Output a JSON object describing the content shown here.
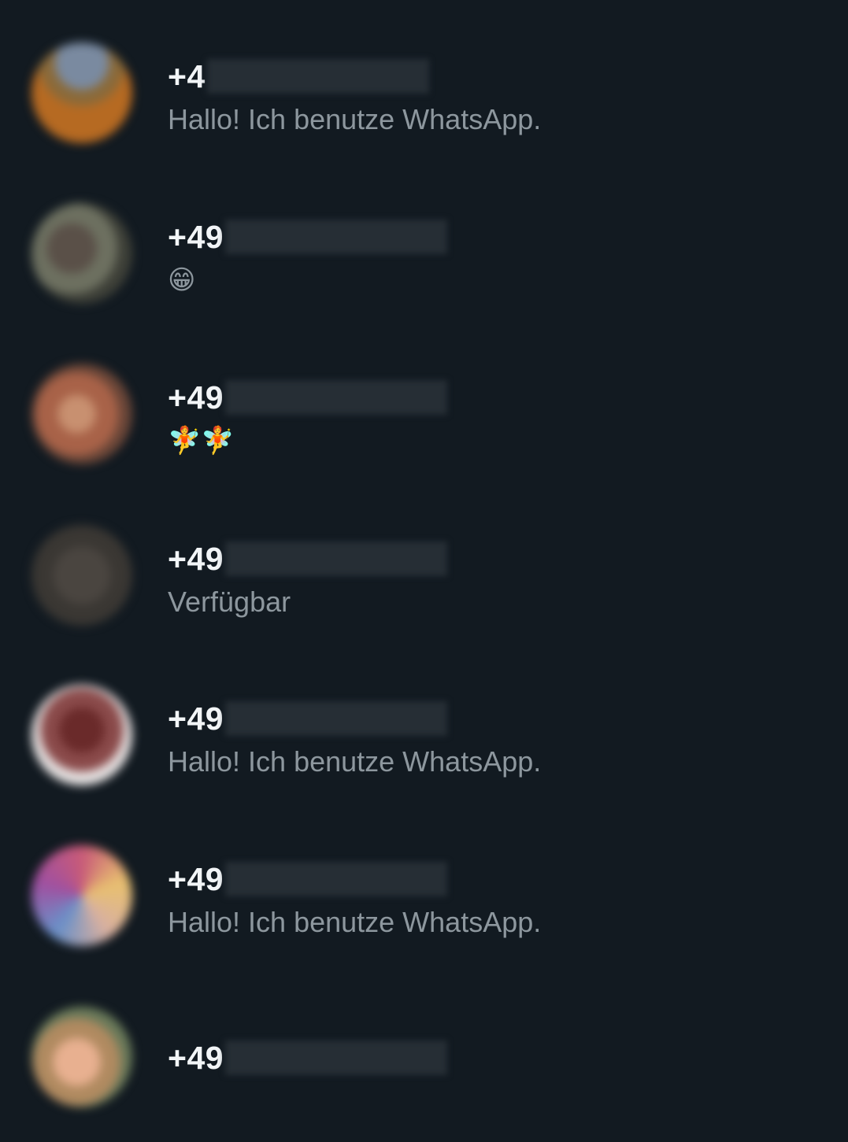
{
  "contacts": [
    {
      "phone_prefix": "+4",
      "status": "Hallo! Ich benutze WhatsApp.",
      "status_kind": "text"
    },
    {
      "phone_prefix": "+49",
      "status": "😁",
      "status_kind": "emoji"
    },
    {
      "phone_prefix": "+49",
      "status": "🧚🧚",
      "status_kind": "emoji"
    },
    {
      "phone_prefix": "+49",
      "status": "Verfügbar",
      "status_kind": "text"
    },
    {
      "phone_prefix": "+49",
      "status": "Hallo! Ich benutze WhatsApp.",
      "status_kind": "text"
    },
    {
      "phone_prefix": "+49",
      "status": "Hallo! Ich benutze WhatsApp.",
      "status_kind": "text"
    },
    {
      "phone_prefix": "+49",
      "status": "",
      "status_kind": "none"
    }
  ],
  "colors": {
    "background": "#121a21",
    "name_text": "#f2f5f7",
    "status_text": "#8d979e"
  }
}
